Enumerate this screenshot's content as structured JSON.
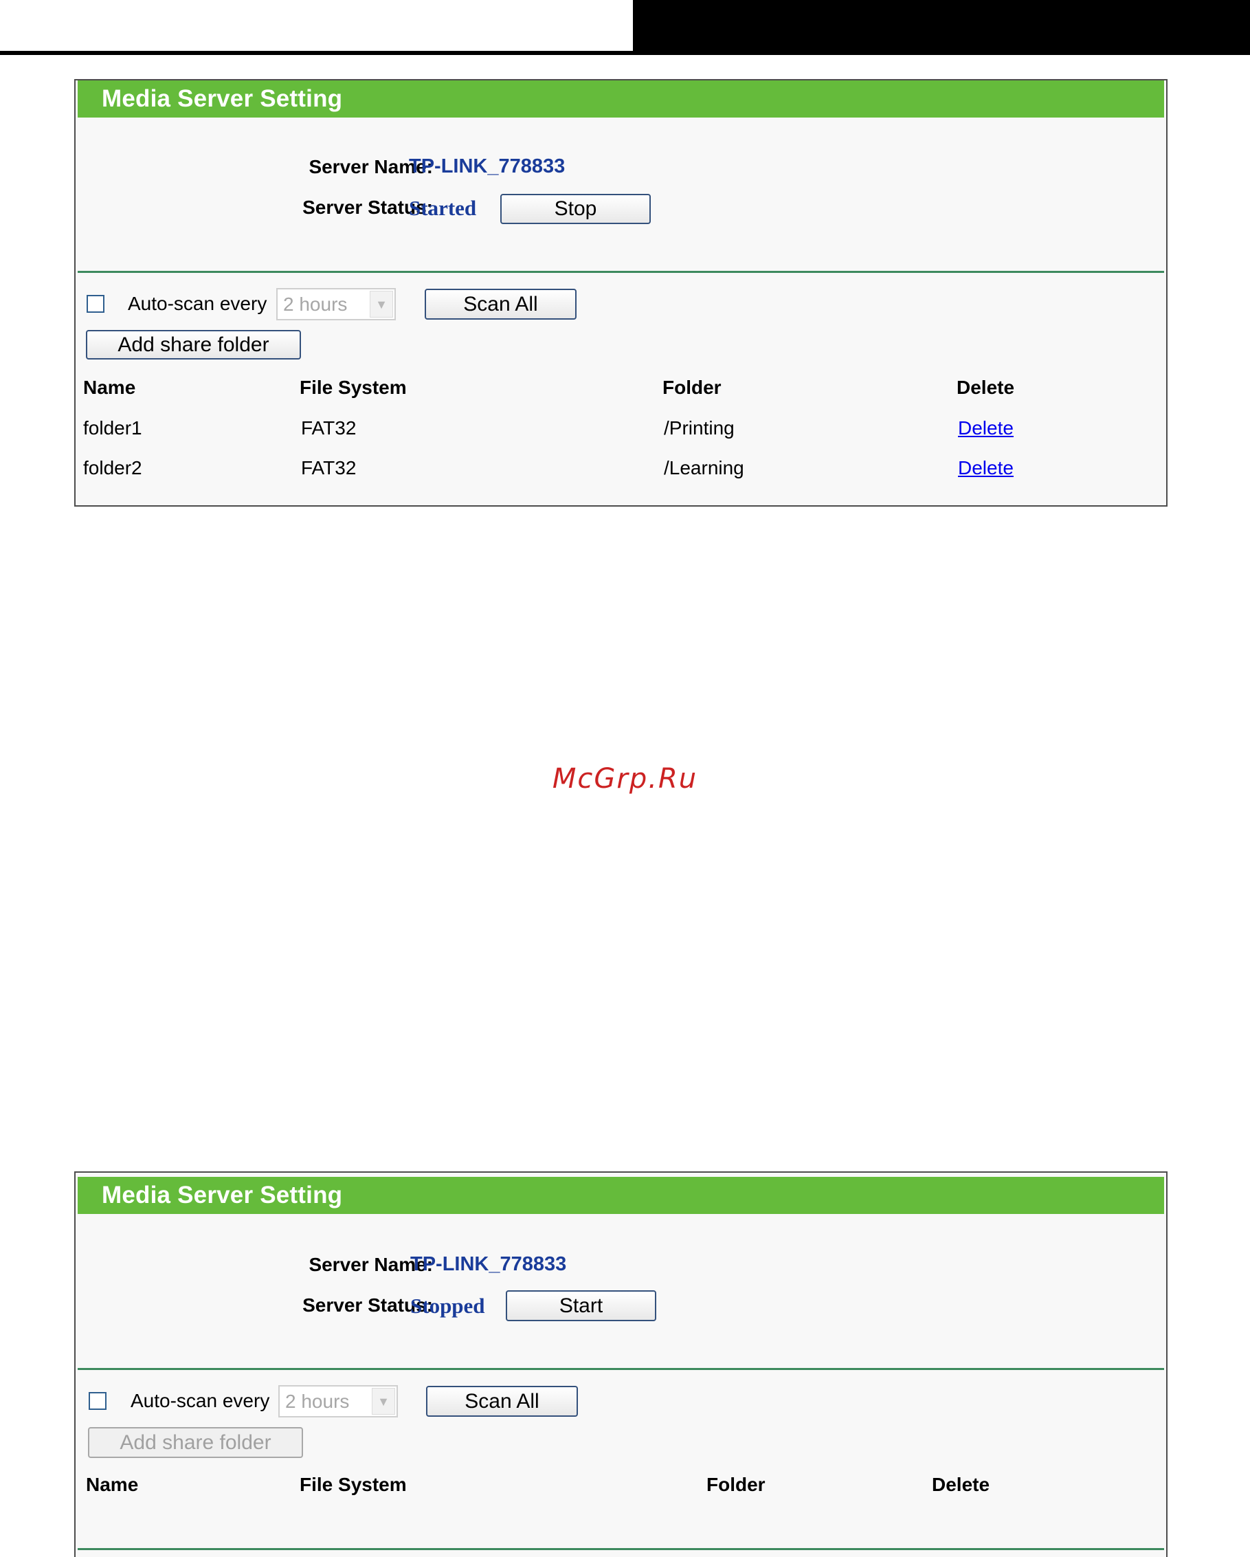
{
  "watermark": "McGrp.Ru",
  "panel1": {
    "title": "Media Server Setting",
    "server_name_label": "Server Name:",
    "server_name_value": "TP-LINK_778833",
    "server_status_label": "Server Status:",
    "server_status_value": "Started",
    "toggle_button": "Stop",
    "auto_scan_label": "Auto-scan every",
    "auto_scan_checked": false,
    "interval_selected": "2 hours",
    "scan_all_button": "Scan All",
    "add_folder_button": "Add share folder",
    "columns": [
      "Name",
      "File System",
      "Folder",
      "Delete"
    ],
    "rows": [
      {
        "name": "folder1",
        "fs": "FAT32",
        "folder": "/Printing",
        "action": "Delete"
      },
      {
        "name": "folder2",
        "fs": "FAT32",
        "folder": "/Learning",
        "action": "Delete"
      }
    ]
  },
  "panel2": {
    "title": "Media Server Setting",
    "server_name_label": "Server Name:",
    "server_name_value": "TP-LINK_778833",
    "server_status_label": "Server Status:",
    "server_status_value": "Stopped",
    "toggle_button": "Start",
    "auto_scan_label": "Auto-scan every",
    "auto_scan_checked": false,
    "interval_selected": "2 hours",
    "scan_all_button": "Scan All",
    "add_folder_button": "Add share folder",
    "add_folder_disabled": true,
    "columns": [
      "Name",
      "File System",
      "Folder",
      "Delete"
    ]
  },
  "colors": {
    "header_green": "#65bb3b",
    "value_blue": "#1a3c9a",
    "separator_green": "#3d8a5e",
    "link_blue": "#0000ee"
  }
}
